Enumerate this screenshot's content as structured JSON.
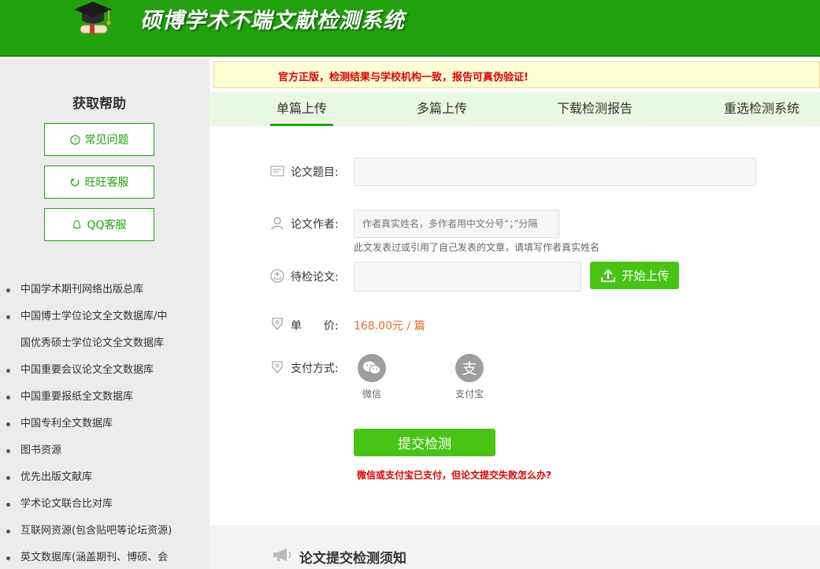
{
  "header": {
    "title": "硕博学术不端文献检测系统"
  },
  "sidebar": {
    "help_title": "获取帮助",
    "help_buttons": [
      {
        "label": "常见问题",
        "icon": "question-circle-icon"
      },
      {
        "label": "旺旺客服",
        "icon": "wangwang-icon"
      },
      {
        "label": "QQ客服",
        "icon": "qq-icon"
      }
    ],
    "databases": [
      "中国学术期刊网络出版总库",
      "中国博士学位论文全文数据库/中",
      "国优秀硕士学位论文全文数据库",
      "中国重要会议论文全文数据库",
      "中国重要报纸全文数据库",
      "中国专利全文数据库",
      "图书资源",
      "优先出版文献库",
      "学术论文联合比对库",
      "互联网资源(包含贴吧等论坛资源)",
      "英文数据库(涵盖期刊、博硕、会"
    ]
  },
  "notice": "官方正版，检测结果与学校机构一致，报告可真伪验证!",
  "tabs": [
    {
      "label": "单篇上传",
      "active": true
    },
    {
      "label": "多篇上传",
      "active": false
    },
    {
      "label": "下载检测报告",
      "active": false
    },
    {
      "label": "重选检测系统",
      "active": false
    }
  ],
  "form": {
    "title_label": "论文题目:",
    "title_value": "",
    "author_label": "论文作者:",
    "author_placeholder": "作者真实姓名，多作者用中文分号“；”分隔",
    "author_hint": "此文发表过或引用了自己发表的文章，请填写作者真实姓名",
    "paper_label": "待检论文:",
    "upload_label": "开始上传",
    "price_label_1": "单",
    "price_label_2": "价:",
    "price_value": "168.00元 / 篇",
    "payment_label": "支付方式:",
    "payment_options": [
      {
        "label": "微信",
        "icon": "wechat-icon"
      },
      {
        "label": "支付宝",
        "icon": "alipay-icon"
      }
    ],
    "submit_label": "提交检测",
    "fail_link": "微信或支付宝已支付，但论文提交失败怎么办?"
  },
  "notes": {
    "title": "论文提交检测须知"
  }
}
